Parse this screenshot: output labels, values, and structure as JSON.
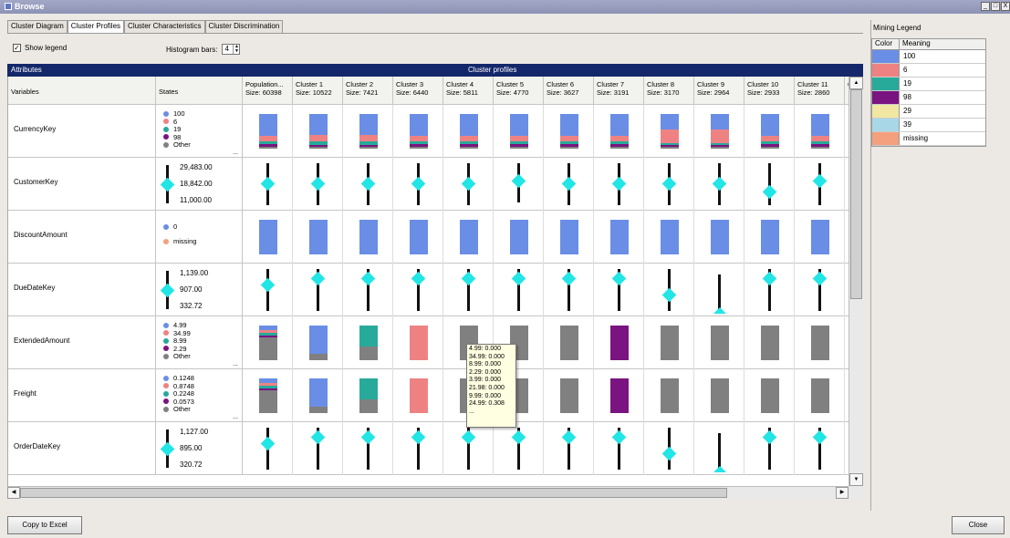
{
  "window": {
    "title": "Browse",
    "controls": [
      "_",
      "□",
      "X"
    ]
  },
  "tabs": [
    "Cluster Diagram",
    "Cluster Profiles",
    "Cluster Characteristics",
    "Cluster Discrimination"
  ],
  "active_tab": 1,
  "options": {
    "show_legend_label": "Show legend",
    "show_legend_checked": true,
    "histogram_label": "Histogram bars:",
    "histogram_value": "4"
  },
  "header": {
    "attributes": "Attributes",
    "cluster_profiles": "Cluster profiles"
  },
  "columns": {
    "variables": "Variables",
    "states": "States",
    "partial": "C S"
  },
  "clusters": [
    {
      "name": "Population...",
      "size": "Size: 60398"
    },
    {
      "name": "Cluster 1",
      "size": "Size: 10522"
    },
    {
      "name": "Cluster 2",
      "size": "Size: 7421"
    },
    {
      "name": "Cluster 3",
      "size": "Size: 6440"
    },
    {
      "name": "Cluster 4",
      "size": "Size: 5811"
    },
    {
      "name": "Cluster 5",
      "size": "Size: 4770"
    },
    {
      "name": "Cluster 6",
      "size": "Size: 3627"
    },
    {
      "name": "Cluster 7",
      "size": "Size: 3191"
    },
    {
      "name": "Cluster 8",
      "size": "Size: 3170"
    },
    {
      "name": "Cluster 9",
      "size": "Size: 2964"
    },
    {
      "name": "Cluster 10",
      "size": "Size: 2933"
    },
    {
      "name": "Cluster 11",
      "size": "Size: 2860"
    }
  ],
  "colors": {
    "blue": "#6a8ee6",
    "salmon": "#ee8283",
    "teal": "#27aa9a",
    "purple": "#7a1480",
    "gray": "#808080",
    "cyan": "#22e5e5",
    "orange": "#f4a07e",
    "yellow": "#f1e7a3",
    "lightblue": "#a8d8e8"
  },
  "rows": [
    {
      "name": "CurrencyKey",
      "kind": "disc",
      "states": [
        {
          "label": "100",
          "color": "#6a8ee6"
        },
        {
          "label": "6",
          "color": "#ee8283"
        },
        {
          "label": "19",
          "color": "#27aa9a"
        },
        {
          "label": "98",
          "color": "#7a1480"
        },
        {
          "label": "Other",
          "color": "#808080"
        }
      ],
      "more": "...",
      "bars": [
        [
          0.62,
          0.18,
          0.08,
          0.07,
          0.05
        ],
        [
          0.6,
          0.2,
          0.09,
          0.07,
          0.04
        ],
        [
          0.6,
          0.2,
          0.09,
          0.07,
          0.04
        ],
        [
          0.62,
          0.18,
          0.08,
          0.07,
          0.05
        ],
        [
          0.62,
          0.18,
          0.08,
          0.07,
          0.05
        ],
        [
          0.62,
          0.18,
          0.08,
          0.07,
          0.05
        ],
        [
          0.62,
          0.18,
          0.08,
          0.07,
          0.05
        ],
        [
          0.62,
          0.18,
          0.08,
          0.07,
          0.05
        ],
        [
          0.45,
          0.38,
          0.07,
          0.06,
          0.04
        ],
        [
          0.45,
          0.38,
          0.07,
          0.06,
          0.04
        ],
        [
          0.62,
          0.18,
          0.08,
          0.07,
          0.05
        ],
        [
          0.62,
          0.18,
          0.08,
          0.07,
          0.05
        ]
      ]
    },
    {
      "name": "CustomerKey",
      "kind": "cont",
      "states": [
        "29,483.00",
        "18,842.00",
        "11,000.00"
      ],
      "marks": [
        {
          "c": 0.5,
          "t": 0.1,
          "b": 0.9
        },
        {
          "c": 0.5,
          "t": 0.1,
          "b": 0.9
        },
        {
          "c": 0.5,
          "t": 0.1,
          "b": 0.9
        },
        {
          "c": 0.5,
          "t": 0.1,
          "b": 0.9
        },
        {
          "c": 0.5,
          "t": 0.1,
          "b": 0.9
        },
        {
          "c": 0.45,
          "t": 0.1,
          "b": 0.85
        },
        {
          "c": 0.5,
          "t": 0.1,
          "b": 0.9
        },
        {
          "c": 0.5,
          "t": 0.1,
          "b": 0.9
        },
        {
          "c": 0.5,
          "t": 0.1,
          "b": 0.9
        },
        {
          "c": 0.5,
          "t": 0.1,
          "b": 0.9
        },
        {
          "c": 0.65,
          "t": 0.1,
          "b": 0.9
        },
        {
          "c": 0.45,
          "t": 0.1,
          "b": 0.9
        }
      ]
    },
    {
      "name": "DiscountAmount",
      "kind": "disc",
      "states": [
        {
          "label": "0",
          "color": "#6a8ee6"
        },
        {
          "label": "missing",
          "color": "#f4a07e"
        }
      ],
      "more": "",
      "bars": [
        [
          1
        ],
        [
          1
        ],
        [
          1
        ],
        [
          1
        ],
        [
          1
        ],
        [
          1
        ],
        [
          1
        ],
        [
          1
        ],
        [
          1
        ],
        [
          1
        ],
        [
          1
        ],
        [
          1
        ]
      ]
    },
    {
      "name": "DueDateKey",
      "kind": "cont",
      "states": [
        "1,139.00",
        "907.00",
        "332.72"
      ],
      "marks": [
        {
          "c": 0.42,
          "t": 0.1,
          "b": 0.9
        },
        {
          "c": 0.3,
          "t": 0.1,
          "b": 0.9
        },
        {
          "c": 0.3,
          "t": 0.1,
          "b": 0.9
        },
        {
          "c": 0.3,
          "t": 0.1,
          "b": 0.9
        },
        {
          "c": 0.3,
          "t": 0.1,
          "b": 0.9
        },
        {
          "c": 0.3,
          "t": 0.1,
          "b": 0.9
        },
        {
          "c": 0.3,
          "t": 0.1,
          "b": 0.9
        },
        {
          "c": 0.3,
          "t": 0.1,
          "b": 0.9
        },
        {
          "c": 0.6,
          "t": 0.1,
          "b": 0.9
        },
        {
          "c": 0.88,
          "t": 0.2,
          "b": 0.88,
          "tri": true
        },
        {
          "c": 0.3,
          "t": 0.1,
          "b": 0.9
        },
        {
          "c": 0.3,
          "t": 0.1,
          "b": 0.9
        }
      ]
    },
    {
      "name": "ExtendedAmount",
      "kind": "disc",
      "states": [
        {
          "label": "4.99",
          "color": "#6a8ee6"
        },
        {
          "label": "34.99",
          "color": "#ee8283"
        },
        {
          "label": "8.99",
          "color": "#27aa9a"
        },
        {
          "label": "2.29",
          "color": "#7a1480"
        },
        {
          "label": "Other",
          "color": "#808080"
        }
      ],
      "more": "...",
      "bars": [
        [
          0.12,
          0.1,
          0.08,
          0.05,
          0.65
        ],
        [
          0.82,
          0,
          0,
          0,
          0.18
        ],
        [
          0,
          0,
          0.6,
          0,
          0.4
        ],
        [
          0,
          1,
          0,
          0,
          0
        ],
        [
          0,
          0,
          0,
          0,
          1
        ],
        [
          0,
          0,
          0,
          0,
          1
        ],
        [
          0,
          0,
          0,
          0,
          1
        ],
        [
          0,
          0,
          0,
          1,
          0
        ],
        [
          0,
          0,
          0,
          0,
          1
        ],
        [
          0,
          0,
          0,
          0,
          1
        ],
        [
          0,
          0,
          0,
          0,
          1
        ],
        [
          0,
          0,
          0,
          0,
          1
        ]
      ]
    },
    {
      "name": "Freight",
      "kind": "disc",
      "states": [
        {
          "label": "0.1248",
          "color": "#6a8ee6"
        },
        {
          "label": "0.8748",
          "color": "#ee8283"
        },
        {
          "label": "0.2248",
          "color": "#27aa9a"
        },
        {
          "label": "0.0573",
          "color": "#7a1480"
        },
        {
          "label": "Other",
          "color": "#808080"
        }
      ],
      "more": "...",
      "bars": [
        [
          0.12,
          0.1,
          0.08,
          0.05,
          0.65
        ],
        [
          0.82,
          0,
          0,
          0,
          0.18
        ],
        [
          0,
          0,
          0.6,
          0,
          0.4
        ],
        [
          0,
          1,
          0,
          0,
          0
        ],
        [
          0,
          0,
          0,
          0,
          1
        ],
        [
          0,
          0,
          0,
          0,
          1
        ],
        [
          0,
          0,
          0,
          0,
          1
        ],
        [
          0,
          0,
          0,
          1,
          0
        ],
        [
          0,
          0,
          0,
          0,
          1
        ],
        [
          0,
          0,
          0,
          0,
          1
        ],
        [
          0,
          0,
          0,
          0,
          1
        ],
        [
          0,
          0,
          0,
          0,
          1
        ]
      ]
    },
    {
      "name": "OrderDateKey",
      "kind": "cont",
      "states": [
        "1,127.00",
        "895.00",
        "320.72"
      ],
      "marks": [
        {
          "c": 0.42,
          "t": 0.1,
          "b": 0.9
        },
        {
          "c": 0.3,
          "t": 0.1,
          "b": 0.9
        },
        {
          "c": 0.3,
          "t": 0.1,
          "b": 0.9
        },
        {
          "c": 0.3,
          "t": 0.1,
          "b": 0.9
        },
        {
          "c": 0.3,
          "t": 0.1,
          "b": 0.9
        },
        {
          "c": 0.3,
          "t": 0.1,
          "b": 0.9
        },
        {
          "c": 0.3,
          "t": 0.1,
          "b": 0.9
        },
        {
          "c": 0.3,
          "t": 0.1,
          "b": 0.9
        },
        {
          "c": 0.6,
          "t": 0.1,
          "b": 0.9
        },
        {
          "c": 0.88,
          "t": 0.2,
          "b": 0.88,
          "tri": true
        },
        {
          "c": 0.3,
          "t": 0.1,
          "b": 0.9
        },
        {
          "c": 0.3,
          "t": 0.1,
          "b": 0.9
        }
      ]
    }
  ],
  "tooltip": {
    "lines": [
      "4.99: 0.000",
      "34.99: 0.000",
      "8.99: 0.000",
      "2.29: 0.000",
      "3.99: 0.000",
      "21.98: 0.000",
      "9.99: 0.000",
      "24.99: 0.308",
      "..."
    ]
  },
  "legend": {
    "title": "Mining Legend",
    "col_color": "Color",
    "col_meaning": "Meaning",
    "items": [
      {
        "meaning": "100",
        "color": "#6a8ee6"
      },
      {
        "meaning": "6",
        "color": "#ee8283"
      },
      {
        "meaning": "19",
        "color": "#27aa9a"
      },
      {
        "meaning": "98",
        "color": "#7a1480"
      },
      {
        "meaning": "29",
        "color": "#f1e7a3"
      },
      {
        "meaning": "39",
        "color": "#a8d8e8"
      },
      {
        "meaning": "missing",
        "color": "#f4a07e"
      }
    ]
  },
  "buttons": {
    "copy": "Copy to Excel",
    "close": "Close"
  }
}
